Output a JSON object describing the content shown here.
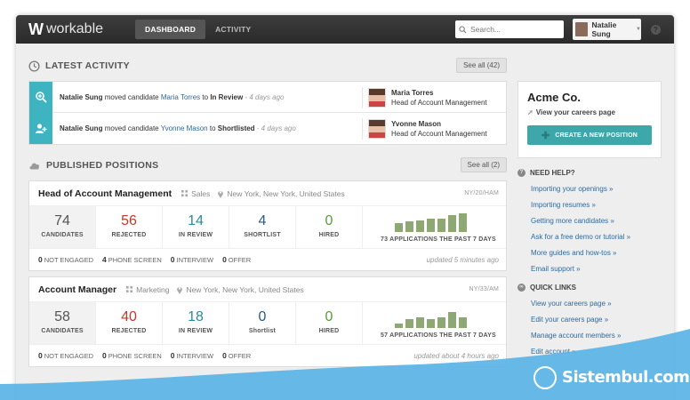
{
  "app": {
    "brand": "workable",
    "brand_mark": "W"
  },
  "nav": {
    "items": [
      "DASHBOARD",
      "ACTIVITY"
    ]
  },
  "search": {
    "placeholder": "Search..."
  },
  "user": {
    "name": "Natalie Sung",
    "help": "?"
  },
  "latest_activity": {
    "title": "LATEST ACTIVITY",
    "see_all": "See all (42)",
    "items": [
      {
        "actor": "Natalie Sung",
        "verb": "moved candidate",
        "candidate": "Maria Torres",
        "prep": "to",
        "stage": "In Review",
        "time": "- 4 days ago",
        "person": "Maria Torres",
        "role": "Head of Account Management",
        "icon": "search-user-icon"
      },
      {
        "actor": "Natalie Sung",
        "verb": "moved candidate",
        "candidate": "Yvonne Mason",
        "prep": "to",
        "stage": "Shortlisted",
        "time": "- 4 days ago",
        "person": "Yvonne Mason",
        "role": "Head of Account Management",
        "icon": "add-user-icon"
      }
    ]
  },
  "published_positions": {
    "title": "PUBLISHED POSITIONS",
    "see_all": "See all (2)",
    "positions": [
      {
        "title": "Head of Account Management",
        "department": "Sales",
        "location": "New York, New York, United States",
        "date": "NY/20/HAM",
        "stats": [
          {
            "value": "74",
            "label": "CANDIDATES"
          },
          {
            "value": "56",
            "label": "REJECTED"
          },
          {
            "value": "14",
            "label": "IN REVIEW"
          },
          {
            "value": "4",
            "label": "SHORTLIST"
          },
          {
            "value": "0",
            "label": "HIRED"
          }
        ],
        "chart_label": "73 APPLICATIONS THE PAST 7 DAYS",
        "chart_bars": [
          0.45,
          0.55,
          0.6,
          0.7,
          0.7,
          0.85,
          0.95
        ],
        "footer": [
          {
            "count": "0",
            "label": "NOT ENGAGED"
          },
          {
            "count": "4",
            "label": "PHONE SCREEN"
          },
          {
            "count": "0",
            "label": "INTERVIEW"
          },
          {
            "count": "0",
            "label": "OFFER"
          }
        ],
        "updated": "updated 5 minutes ago"
      },
      {
        "title": "Account Manager",
        "department": "Marketing",
        "location": "New York, New York, United States",
        "date": "NY/33/AM",
        "stats": [
          {
            "value": "58",
            "label": "CANDIDATES"
          },
          {
            "value": "40",
            "label": "REJECTED"
          },
          {
            "value": "18",
            "label": "IN REVIEW"
          },
          {
            "value": "0",
            "label": "Shortlist"
          },
          {
            "value": "0",
            "label": "HIRED"
          }
        ],
        "chart_label": "57 APPLICATIONS THE PAST 7 DAYS",
        "chart_bars": [
          0.25,
          0.45,
          0.55,
          0.45,
          0.55,
          0.8,
          0.55
        ],
        "footer": [
          {
            "count": "0",
            "label": "NOT ENGAGED"
          },
          {
            "count": "0",
            "label": "PHONE SCREEN"
          },
          {
            "count": "0",
            "label": "INTERVIEW"
          },
          {
            "count": "0",
            "label": "OFFER"
          }
        ],
        "updated": "updated about 4 hours ago"
      }
    ]
  },
  "company": {
    "name": "Acme Co.",
    "careers_link": "View your careers page",
    "create_button": "CREATE A NEW POSITION"
  },
  "need_help": {
    "title": "NEED HELP?",
    "links": [
      "Importing your openings »",
      "Importing resumes »",
      "Getting more candidates »",
      "Ask for a free demo or tutorial »",
      "More guides and how-tos »",
      "Email support »"
    ]
  },
  "quick_links": {
    "title": "QUICK LINKS",
    "links": [
      "View your careers page »",
      "Edit your careers page »",
      "Manage account members »",
      "Edit account »"
    ]
  },
  "watermark": {
    "text": "Sistembul.com"
  },
  "colors": {
    "accent": "#3da7aa",
    "topbar": "#2f2f2f",
    "link": "#2c6aa0",
    "bars": "#8ea874"
  }
}
